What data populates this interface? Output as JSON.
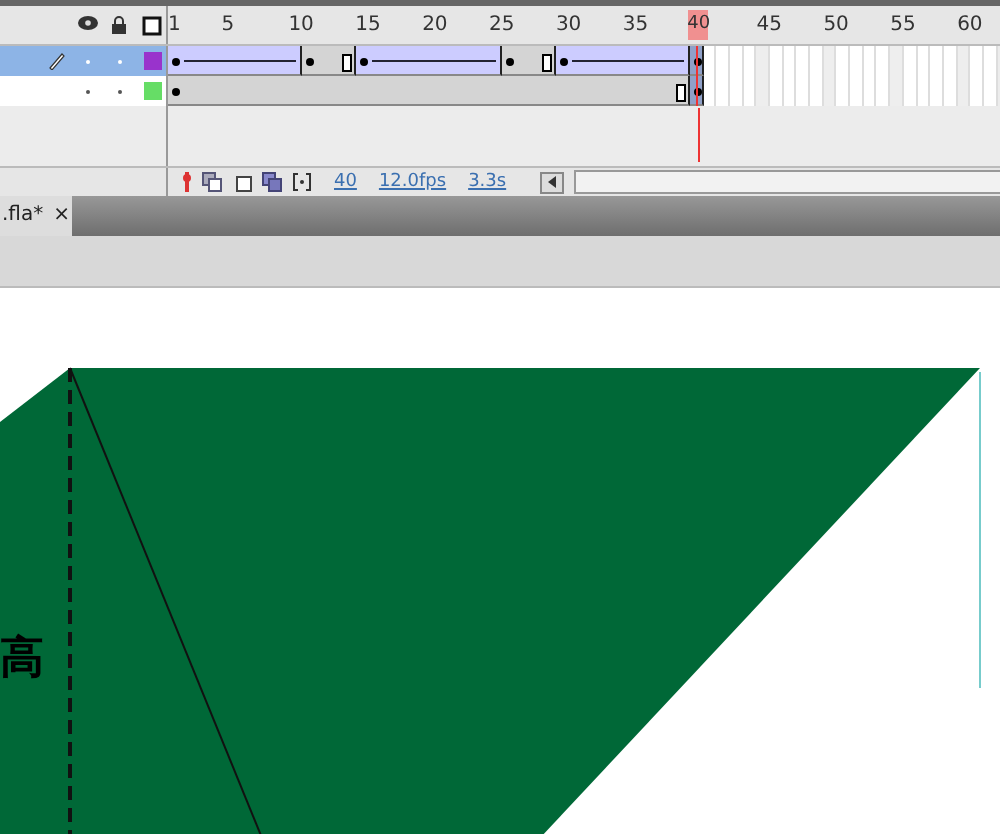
{
  "timeline": {
    "frame_numbers": [
      "1",
      "5",
      "10",
      "15",
      "20",
      "25",
      "30",
      "35",
      "45",
      "50",
      "55",
      "60"
    ],
    "playhead": {
      "label": "40"
    },
    "layers": [
      {
        "selected": true,
        "editing": true,
        "color": "#9933cc",
        "frames": [
          {
            "kind": "key"
          },
          {
            "kind": "tween"
          },
          {
            "kind": "tween"
          },
          {
            "kind": "tween"
          },
          {
            "kind": "tween"
          },
          {
            "kind": "tween"
          },
          {
            "kind": "tween"
          },
          {
            "kind": "tween"
          },
          {
            "kind": "tween"
          },
          {
            "kind": "tween"
          },
          {
            "kind": "key"
          },
          {
            "kind": "hold"
          },
          {
            "kind": "hold"
          },
          {
            "kind": "end"
          },
          {
            "kind": "key"
          },
          {
            "kind": "tween"
          },
          {
            "kind": "tween"
          },
          {
            "kind": "tween"
          },
          {
            "kind": "tween"
          },
          {
            "kind": "tween"
          },
          {
            "kind": "tween"
          },
          {
            "kind": "tween"
          },
          {
            "kind": "tween"
          },
          {
            "kind": "tween"
          },
          {
            "kind": "tween"
          },
          {
            "kind": "key"
          },
          {
            "kind": "hold"
          },
          {
            "kind": "hold"
          },
          {
            "kind": "end"
          },
          {
            "kind": "key"
          },
          {
            "kind": "tween"
          },
          {
            "kind": "tween"
          },
          {
            "kind": "tween"
          },
          {
            "kind": "tween"
          },
          {
            "kind": "tween"
          },
          {
            "kind": "tween"
          },
          {
            "kind": "tween"
          },
          {
            "kind": "tween"
          },
          {
            "kind": "tween"
          },
          {
            "kind": "key"
          }
        ]
      },
      {
        "selected": false,
        "editing": false,
        "color": "#66dd66",
        "frames": [
          {
            "kind": "key"
          },
          {
            "kind": "hold"
          },
          {
            "kind": "hold"
          },
          {
            "kind": "hold"
          },
          {
            "kind": "hold"
          },
          {
            "kind": "hold"
          },
          {
            "kind": "hold"
          },
          {
            "kind": "hold"
          },
          {
            "kind": "hold"
          },
          {
            "kind": "hold"
          },
          {
            "kind": "hold"
          },
          {
            "kind": "hold"
          },
          {
            "kind": "hold"
          },
          {
            "kind": "hold"
          },
          {
            "kind": "hold"
          },
          {
            "kind": "hold"
          },
          {
            "kind": "hold"
          },
          {
            "kind": "hold"
          },
          {
            "kind": "hold"
          },
          {
            "kind": "hold"
          },
          {
            "kind": "hold"
          },
          {
            "kind": "hold"
          },
          {
            "kind": "hold"
          },
          {
            "kind": "hold"
          },
          {
            "kind": "hold"
          },
          {
            "kind": "hold"
          },
          {
            "kind": "hold"
          },
          {
            "kind": "hold"
          },
          {
            "kind": "hold"
          },
          {
            "kind": "hold"
          },
          {
            "kind": "hold"
          },
          {
            "kind": "hold"
          },
          {
            "kind": "hold"
          },
          {
            "kind": "hold"
          },
          {
            "kind": "hold"
          },
          {
            "kind": "hold"
          },
          {
            "kind": "hold"
          },
          {
            "kind": "hold"
          },
          {
            "kind": "end"
          },
          {
            "kind": "key"
          }
        ]
      }
    ],
    "status": {
      "current_frame": "40",
      "frame_rate": "12.0fps",
      "elapsed": "3.3s"
    }
  },
  "document_tab": {
    "title": ".fla*",
    "close": "×"
  },
  "stage": {
    "label": "高"
  }
}
